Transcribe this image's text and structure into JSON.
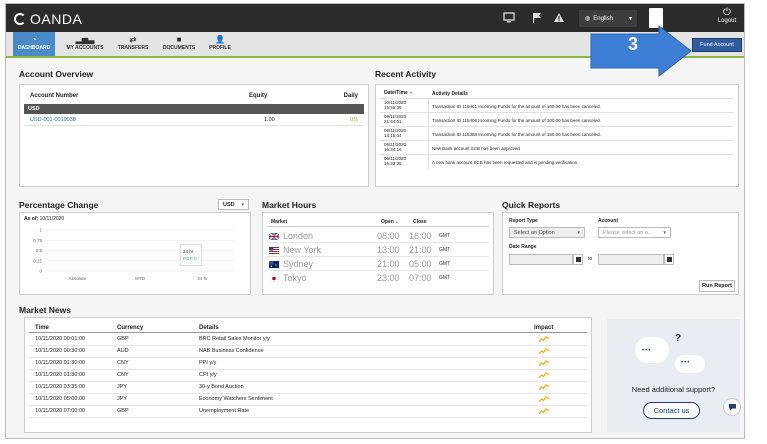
{
  "brand": {
    "name": "OANDA"
  },
  "topbar": {
    "language": "English",
    "logout_label": "Logout"
  },
  "nav": [
    {
      "label": "DASHBOARD",
      "icon": "dashboard-icon",
      "active": true
    },
    {
      "label": "MY ACCOUNTS",
      "icon": "bar-chart-icon"
    },
    {
      "label": "TRANSFERS",
      "icon": "transfer-icon"
    },
    {
      "label": "DOCUMENTS",
      "icon": "folder-icon"
    },
    {
      "label": "PROFILE",
      "icon": "user-icon"
    }
  ],
  "fund_account_label": "Fund Account",
  "callout_number": "3",
  "colors": {
    "accent": "#4a8ac9",
    "nav_underline": "#8bb63f",
    "callout": "#3d7fd6",
    "fund_button": "#2f5d9e"
  },
  "account_overview": {
    "title": "Account Overview",
    "columns": [
      "Account Number",
      "Equity",
      "Daily"
    ],
    "currency_group": "USD",
    "rows": [
      {
        "account": "USD-001-0010038",
        "equity": "1.00",
        "daily": "0%"
      }
    ]
  },
  "recent_activity": {
    "title": "Recent Activity",
    "columns": [
      "Date/Time",
      "Activity Details"
    ],
    "sort_indicator": "▼",
    "rows": [
      {
        "date": "10/11/2020",
        "time": "15:55:39",
        "details": "Transaction ID 115461 Incoming Funds for the amount of 100.00 has been canceled."
      },
      {
        "date": "09/11/2020",
        "time": "21:44:01",
        "details": "Transaction ID 115406 Incoming Funds for the amount of 100.00 has been canceled."
      },
      {
        "date": "09/11/2020",
        "time": "14:15:04",
        "details": "Transaction ID 115388 Incoming Funds for the amount of 150.00 has been canceled."
      },
      {
        "date": "06/11/2020",
        "time": "16:34:16",
        "details": "New Bank account SCB has been approved"
      },
      {
        "date": "06/11/2020",
        "time": "16:33:35",
        "details": "A new bank account SCB has been requested and is pending verification."
      }
    ]
  },
  "percentage_change": {
    "title": "Percentage Change",
    "currency": "USD",
    "as_of_label": "As of:",
    "as_of_date": "10/11/2020",
    "tooltip_line1": "24 hr",
    "tooltip_line2": "PCT: 0"
  },
  "chart_data": {
    "type": "bar",
    "categories": [
      "Absolute",
      "MTD",
      "24 hr"
    ],
    "values": [
      0,
      0,
      0
    ],
    "ylim": [
      0,
      1
    ],
    "y_ticks": [
      "1",
      "0.75",
      "0.5",
      "0.25",
      "0"
    ],
    "grid": true
  },
  "market_hours": {
    "title": "Market Hours",
    "columns": [
      "Market",
      "Open",
      "Close"
    ],
    "sort_indicator": "▲",
    "rows": [
      {
        "market": "London",
        "open": "08:00",
        "close": "16:00",
        "tz": "GMT",
        "flag": "uk-flag-icon"
      },
      {
        "market": "New York",
        "open": "13:00",
        "close": "21:00",
        "tz": "GMT",
        "flag": "us-flag-icon"
      },
      {
        "market": "Sydney",
        "open": "21:00",
        "close": "05:00",
        "tz": "GMT",
        "flag": "au-flag-icon"
      },
      {
        "market": "Tokyo",
        "open": "23:00",
        "close": "07:00",
        "tz": "GMT",
        "flag": "jp-flag-icon"
      }
    ]
  },
  "quick_reports": {
    "title": "Quick Reports",
    "report_type_label": "Report Type",
    "report_type_value": "Select an Option",
    "account_label": "Account",
    "account_placeholder": "Please select an a...",
    "date_range_label": "Date Range",
    "to_label": "to",
    "run_label": "Run Report"
  },
  "market_news": {
    "title": "Market News",
    "columns": [
      "Time",
      "Currency",
      "Details",
      "Impact"
    ],
    "rows": [
      {
        "time": "10/11/2020 00:01:00",
        "currency": "GBP",
        "details": "BRC Retail Sales Monitor y/y"
      },
      {
        "time": "10/11/2020 00:30:00",
        "currency": "AUD",
        "details": "NAB Business Confidence"
      },
      {
        "time": "10/11/2020 01:30:00",
        "currency": "CNY",
        "details": "PPI y/y"
      },
      {
        "time": "10/11/2020 01:30:00",
        "currency": "CNY",
        "details": "CPI y/y"
      },
      {
        "time": "10/11/2020 03:35:00",
        "currency": "JPY",
        "details": "30-y Bond Auction"
      },
      {
        "time": "10/11/2020 05:00:00",
        "currency": "JPY",
        "details": "Economy Watchers Sentiment"
      },
      {
        "time": "10/11/2020 07:00:00",
        "currency": "GBP",
        "details": "Unemployment Rate"
      }
    ]
  },
  "support": {
    "question_mark": "?",
    "text": "Need additional support?",
    "contact_label": "Contact us"
  }
}
